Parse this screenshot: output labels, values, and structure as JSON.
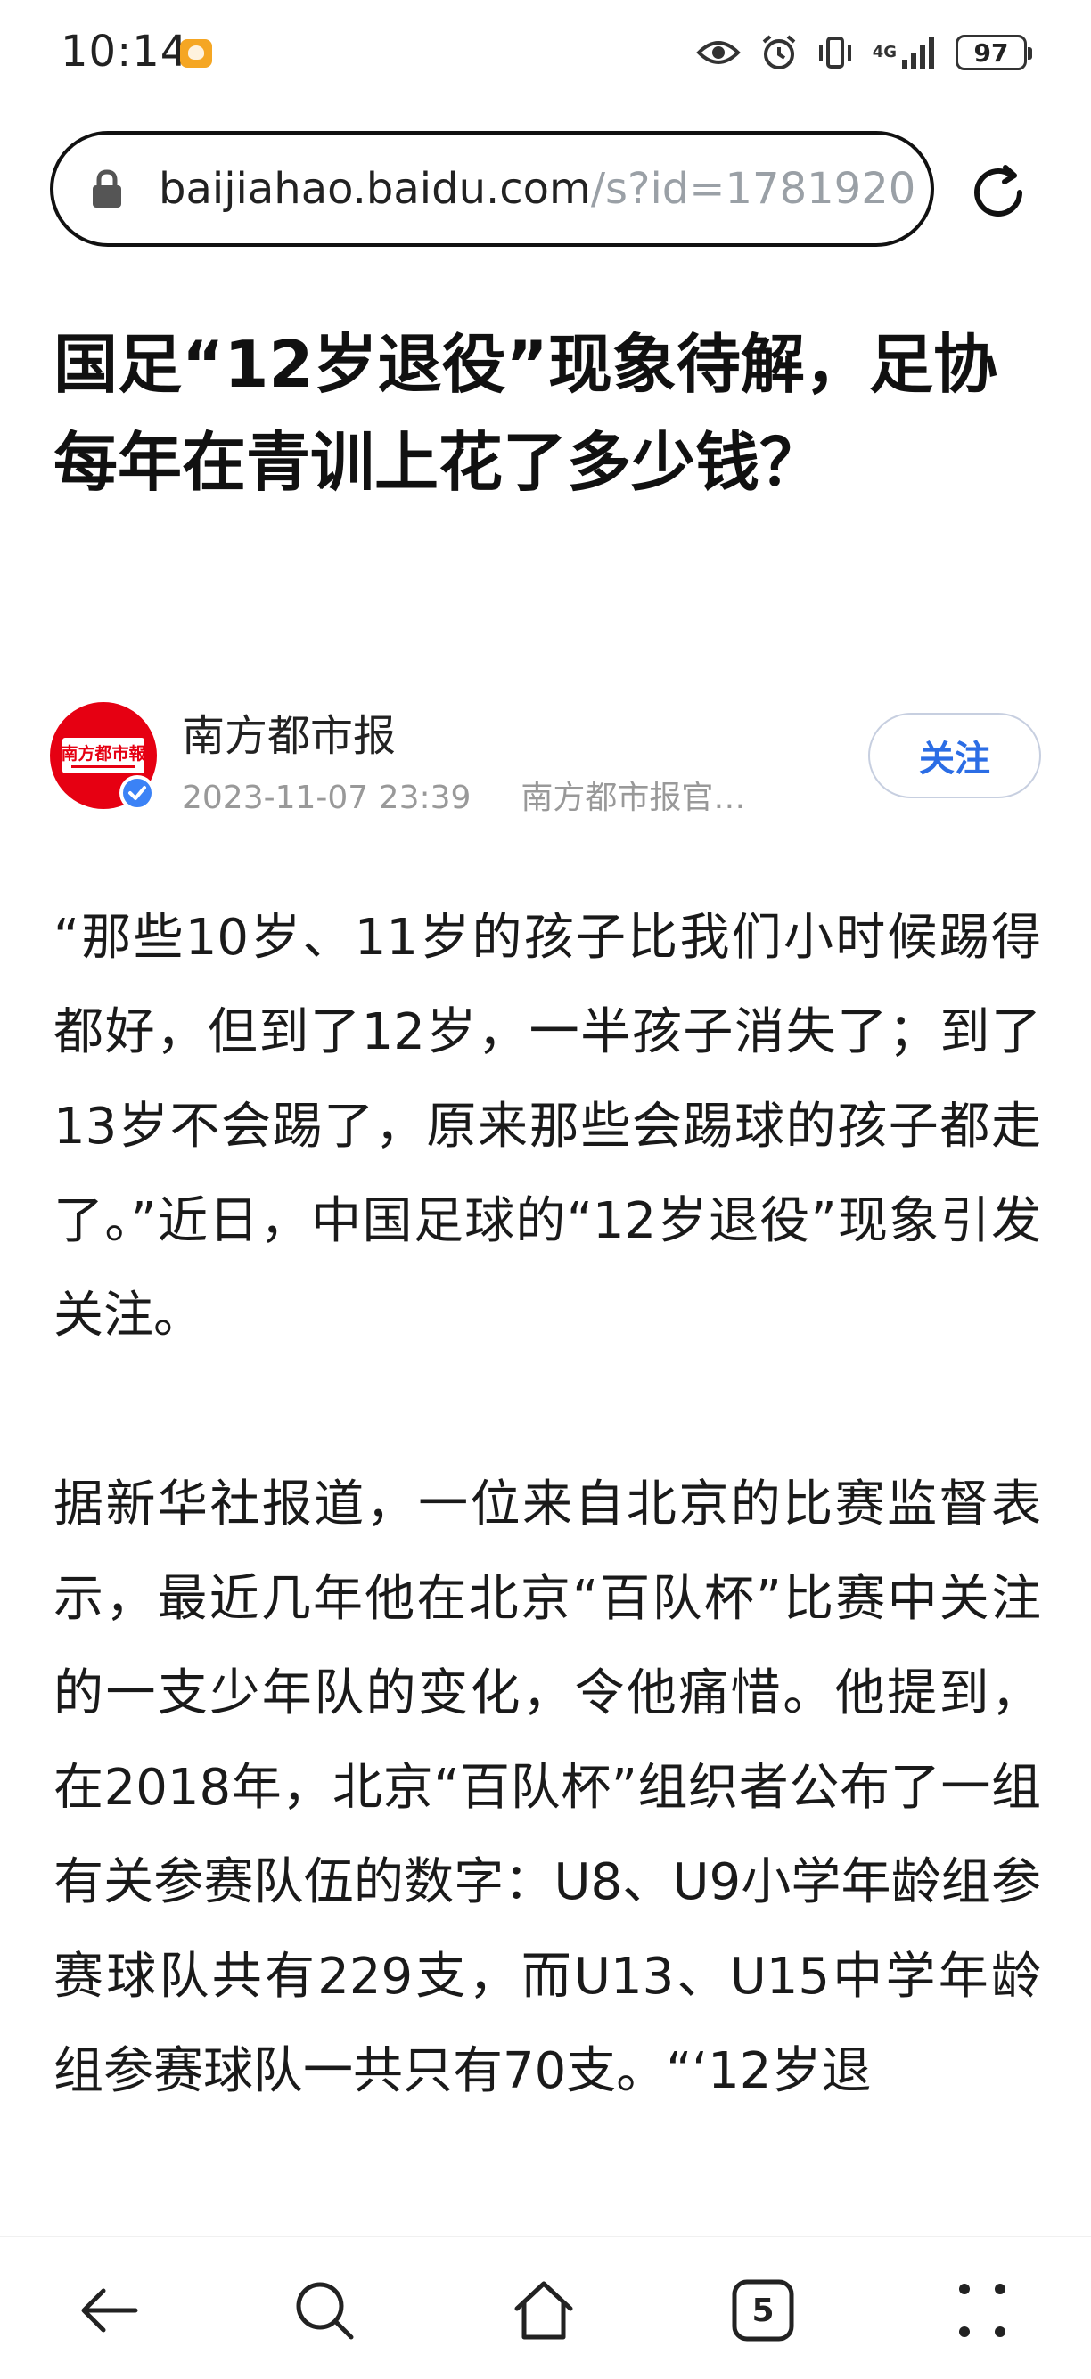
{
  "status_bar": {
    "time": "10:14",
    "network": "4G",
    "battery": "97",
    "icons": [
      "app-notification-icon",
      "eye-icon",
      "alarm-icon",
      "vibrate-icon",
      "signal-icon",
      "battery-icon"
    ]
  },
  "url_bar": {
    "host": "baijiahao.baidu.com",
    "path": "/s?id=1781920",
    "icons": [
      "lock-icon",
      "reload-icon"
    ]
  },
  "article": {
    "title": "国足“12岁退役”现象待解，足协每年在青训上花了多少钱？",
    "author": {
      "name": "南方都市报",
      "logo_text": "南方都市報",
      "date": "2023-11-07 23:39",
      "source": "南方都市报官…",
      "follow_label": "关注"
    },
    "paragraphs": [
      "“那些10岁、11岁的孩子比我们小时候踢得都好，但到了12岁，一半孩子消失了；到了13岁不会踢了，原来那些会踢球的孩子都走了。”近日，中国足球的“12岁退役”现象引发关注。",
      "据新华社报道，一位来自北京的比赛监督表示，最近几年他在北京“百队杯”比赛中关注的一支少年队的变化，令他痛惜。他提到，在2018年，北京“百队杯”组织者公布了一组有关参赛队伍的数字：U8、U9小学年龄组参赛球队共有229支，而U13、U15中学年龄组参赛球队一共只有70支。“‘12岁退"
    ]
  },
  "bottom_nav": {
    "tab_count": "5",
    "icons": [
      "back-icon",
      "search-icon",
      "home-icon",
      "tabs-icon",
      "more-icon"
    ]
  },
  "colors": {
    "accent": "#2b6de5",
    "logo_red": "#e60012",
    "meta_gray": "#999999"
  }
}
